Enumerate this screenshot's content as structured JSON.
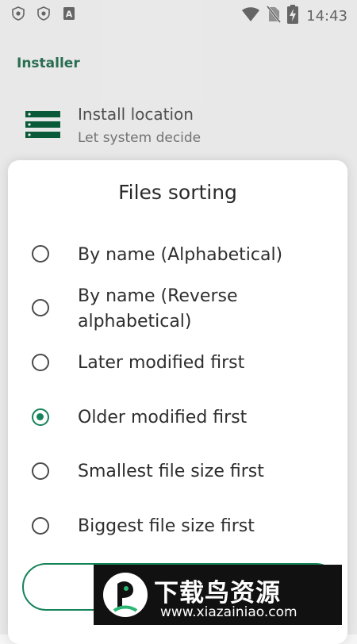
{
  "status_bar": {
    "time": "14:43",
    "left_icons": [
      "shield-icon",
      "shield-icon",
      "a-letter-icon"
    ],
    "right_icons": [
      "wifi-icon",
      "no-sim-icon",
      "battery-charging-icon"
    ],
    "letter_badge": "A"
  },
  "settings": {
    "section_header": "Installer",
    "install_location": {
      "title": "Install location",
      "value": "Let system decide",
      "icon": "storage-list-icon"
    }
  },
  "dialog": {
    "title": "Files sorting",
    "options": [
      {
        "label": "By name (Alphabetical)",
        "selected": false
      },
      {
        "label": "By name (Reverse alphabetical)",
        "selected": false
      },
      {
        "label": "Later modified first",
        "selected": false
      },
      {
        "label": "Older modified first",
        "selected": true
      },
      {
        "label": "Smallest file size first",
        "selected": false
      },
      {
        "label": "Biggest file size first",
        "selected": false
      }
    ],
    "button_label": ""
  },
  "watermark": {
    "title": "下载鸟资源",
    "url": "www.xiazainiao.com"
  },
  "colors": {
    "accent": "#16835a",
    "header": "#0b5e3b",
    "text_primary": "#2e2e2e",
    "text_secondary": "#7a7a7a"
  }
}
